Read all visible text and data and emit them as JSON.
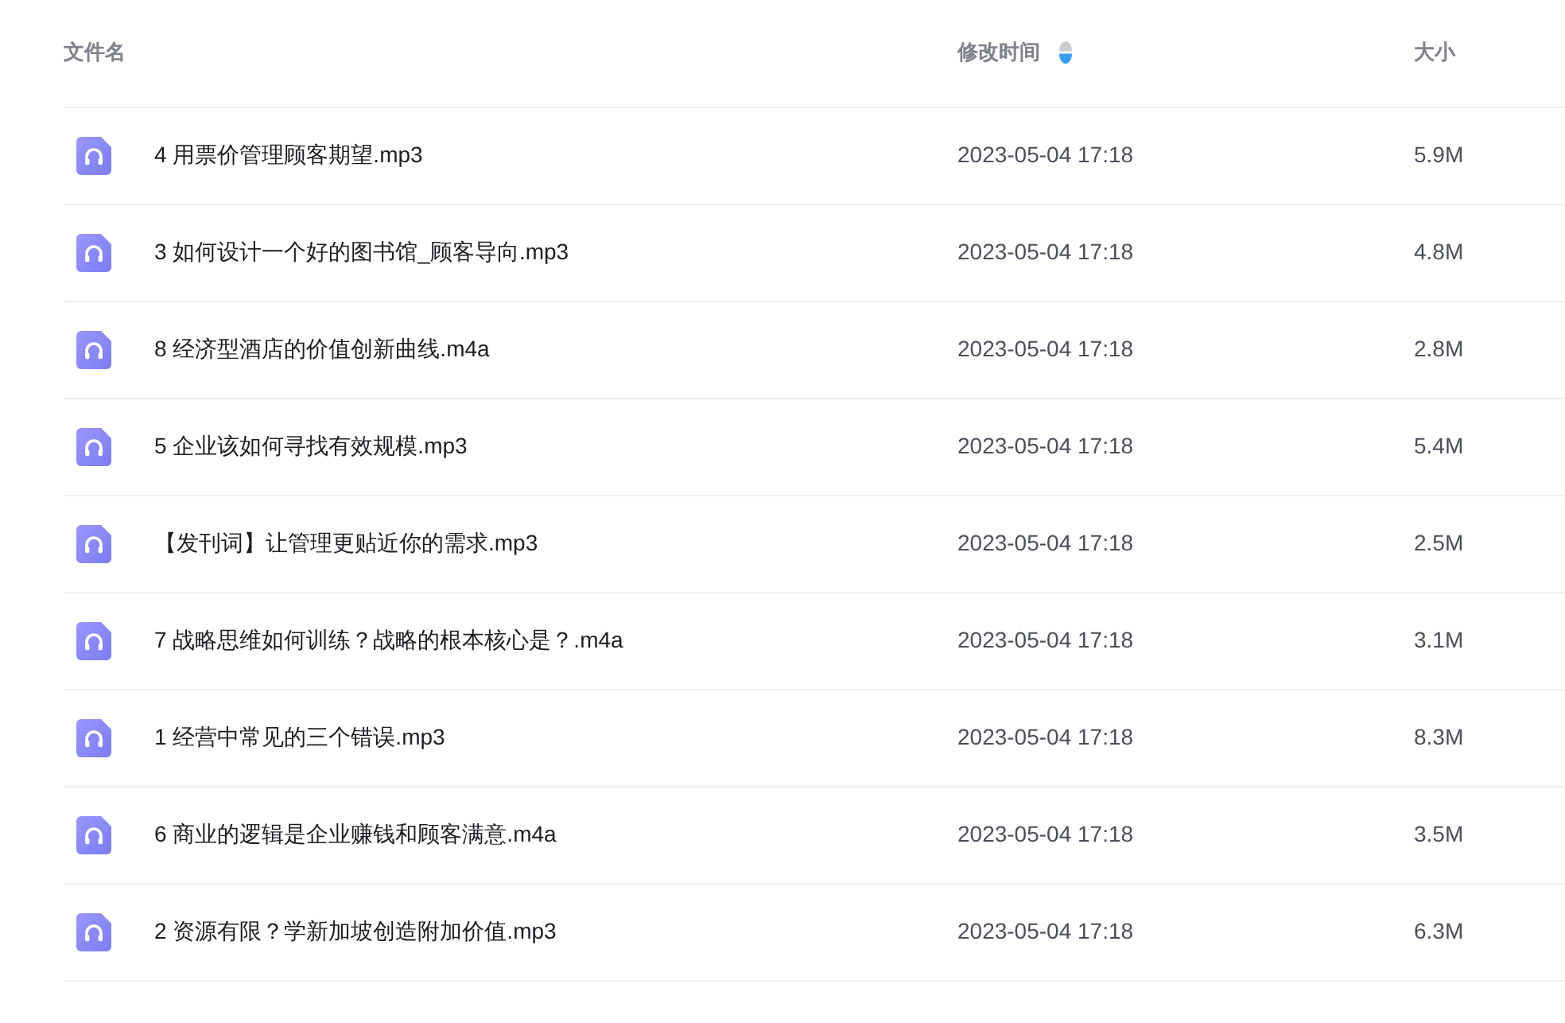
{
  "table": {
    "columns": [
      {
        "label": "文件名",
        "sortable": false
      },
      {
        "label": "修改时间",
        "sortable": true,
        "descending": true
      },
      {
        "label": "大小",
        "sortable": false
      }
    ],
    "rows": [
      {
        "name": "4 用票价管理顾客期望.mp3",
        "modified": "2023-05-04 17:18",
        "size": "5.9M"
      },
      {
        "name": "3 如何设计一个好的图书馆_顾客导向.mp3",
        "modified": "2023-05-04 17:18",
        "size": "4.8M"
      },
      {
        "name": "8 经济型酒店的价值创新曲线.m4a",
        "modified": "2023-05-04 17:18",
        "size": "2.8M"
      },
      {
        "name": "5 企业该如何寻找有效规模.mp3",
        "modified": "2023-05-04 17:18",
        "size": "5.4M"
      },
      {
        "name": "【发刊词】让管理更贴近你的需求.mp3",
        "modified": "2023-05-04 17:18",
        "size": "2.5M"
      },
      {
        "name": "7 战略思维如何训练？战略的根本核心是？.m4a",
        "modified": "2023-05-04 17:18",
        "size": "3.1M"
      },
      {
        "name": "1 经营中常见的三个错误.mp3",
        "modified": "2023-05-04 17:18",
        "size": "8.3M"
      },
      {
        "name": "6 商业的逻辑是企业赚钱和顾客满意.m4a",
        "modified": "2023-05-04 17:18",
        "size": "3.5M"
      },
      {
        "name": "2 资源有限？学新加坡创造附加价值.mp3",
        "modified": "2023-05-04 17:18",
        "size": "6.3M"
      }
    ]
  }
}
